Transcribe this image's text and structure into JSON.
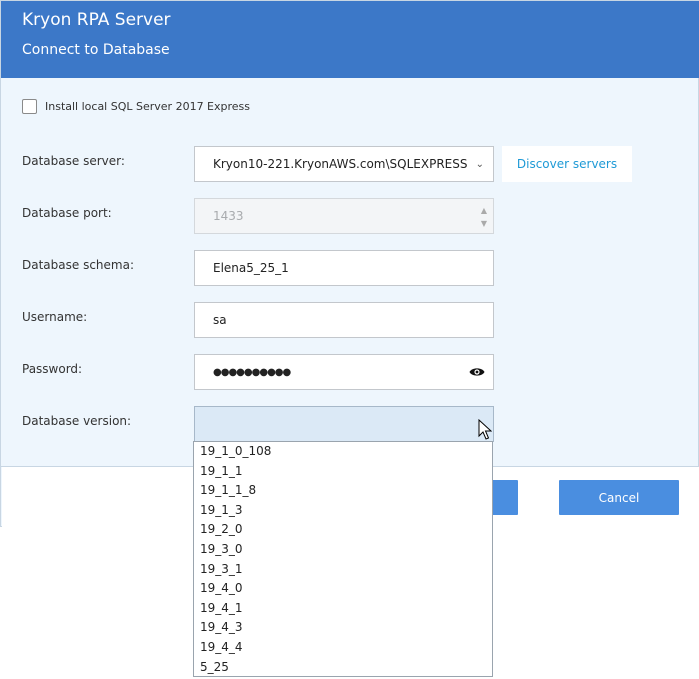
{
  "header": {
    "title": "Kryon RPA Server",
    "subtitle": "Connect to Database"
  },
  "install_checkbox": {
    "label": "Install local SQL Server 2017 Express",
    "checked": false
  },
  "form": {
    "server": {
      "label": "Database server:",
      "value": "Kryon10-221.KryonAWS.com\\SQLEXPRESS"
    },
    "discover_label": "Discover servers",
    "port": {
      "label": "Database port:",
      "value": "1433"
    },
    "schema": {
      "label": "Database schema:",
      "value": "Elena5_25_1"
    },
    "username": {
      "label": "Username:",
      "value": "sa"
    },
    "password": {
      "label": "Password:",
      "value": "●●●●●●●●●●"
    },
    "version": {
      "label": "Database version:",
      "value": ""
    }
  },
  "version_options": [
    "19_1_0_108",
    "19_1_1",
    "19_1_1_8",
    "19_1_3",
    "19_2_0",
    "19_3_0",
    "19_3_1",
    "19_4_0",
    "19_4_1",
    "19_4_3",
    "19_4_4",
    "5_25"
  ],
  "buttons": {
    "ok": "",
    "cancel": "Cancel"
  },
  "colors": {
    "header": "#3c78c8",
    "button": "#4a8ee0",
    "link": "#1e9ad6",
    "background": "#eef6fd"
  },
  "icons": {
    "chevron": "chevron-down-icon",
    "eye": "eye-icon",
    "cursor": "mouse-cursor-icon"
  }
}
